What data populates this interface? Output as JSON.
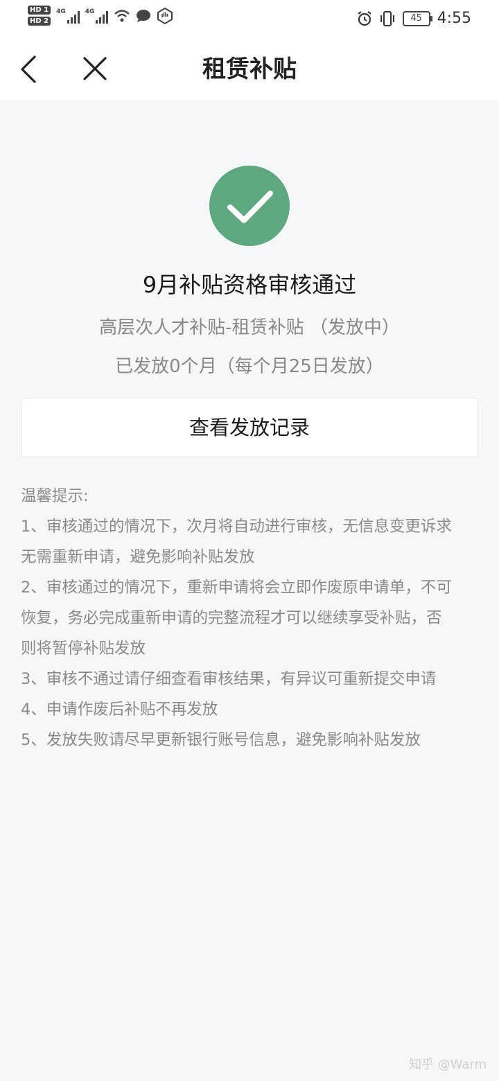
{
  "status_bar": {
    "sim1": "HD 1",
    "sim2": "HD 2",
    "net1": "4G",
    "net2": "4G",
    "battery": "45",
    "time": "4:55"
  },
  "nav": {
    "title": "租赁补贴"
  },
  "result": {
    "title": "9月补贴资格审核通过",
    "subtitle": "高层次人才补贴-租赁补贴 （发放中）",
    "issued": "已发放0个月（每个月25日发放）"
  },
  "record_button": {
    "label": "查看发放记录"
  },
  "tips": {
    "heading": "温馨提示:",
    "lines": [
      "1、审核通过的情况下，次月将自动进行审核，无信息变更诉求",
      "无需重新申请，避免影响补贴发放",
      "2、审核通过的情况下，重新申请将会立即作废原申请单，不可",
      "恢复，务必完成重新申请的完整流程才可以继续享受补贴，否",
      "则将暂停补贴发放",
      "3、审核不通过请仔细查看审核结果，有异议可重新提交申请",
      "4、申请作废后补贴不再发放",
      "5、发放失败请尽早更新银行账号信息，避免影响补贴发放"
    ]
  },
  "watermark": "知乎 @Warm",
  "colors": {
    "success_green": "#5ea880",
    "background": "#f5f7f9",
    "muted_text": "#888888"
  }
}
